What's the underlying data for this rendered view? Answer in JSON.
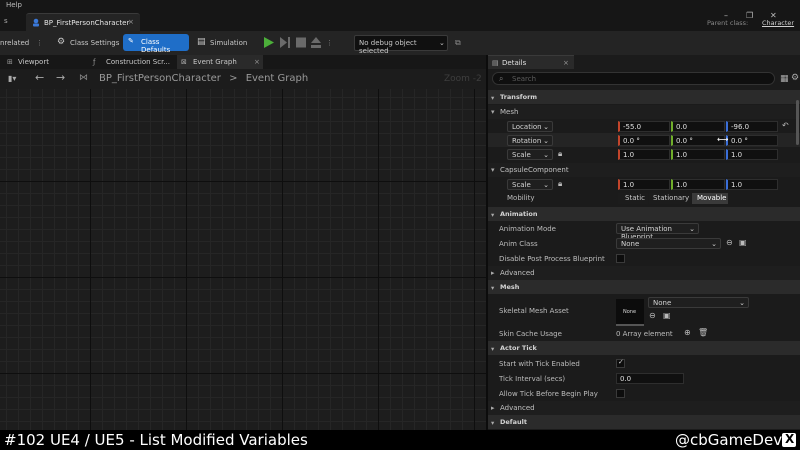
{
  "window": {
    "menu_help": "Help",
    "tab_title": "BP_FirstPersonCharacter",
    "tab_close": "×",
    "parent_class_label": "Parent class:",
    "parent_class_value": "Character"
  },
  "toolbar": {
    "unrelated": "nrelated",
    "class_settings": "Class Settings",
    "class_defaults": "Class Defaults",
    "simulation": "Simulation",
    "debug_object": "No debug object selected"
  },
  "left_tabs": [
    {
      "label": "Viewport"
    },
    {
      "label": "Construction Scr..."
    },
    {
      "label": "Event Graph",
      "close": "×"
    }
  ],
  "graph": {
    "breadcrumb_root": "BP_FirstPersonCharacter",
    "breadcrumb_sep": ">",
    "breadcrumb_leaf": "Event Graph",
    "zoom": "Zoom -2"
  },
  "details": {
    "tab_label": "Details",
    "tab_close": "×",
    "search_placeholder": "Search",
    "sections": {
      "transform": "Transform",
      "mesh_sub": "Mesh",
      "capsule_sub": "CapsuleComponent",
      "animation": "Animation",
      "advanced": "Advanced",
      "mesh": "Mesh",
      "actor_tick": "Actor Tick",
      "advanced2": "Advanced",
      "default": "Default"
    },
    "transform": {
      "location": {
        "label": "Location",
        "x": "-55.0",
        "y": "0.0",
        "z": "-96.0"
      },
      "rotation": {
        "label": "Rotation",
        "x": "0.0 °",
        "y": "0.0 °",
        "z": "0.0 °"
      },
      "scale": {
        "label": "Scale",
        "x": "1.0",
        "y": "1.0",
        "z": "1.0"
      },
      "capsule_scale": {
        "label": "Scale",
        "x": "1.0",
        "y": "1.0",
        "z": "1.0"
      },
      "mobility_label": "Mobility",
      "mobility_options": [
        "Static",
        "Stationary",
        "Movable"
      ],
      "mobility_selected": "Movable"
    },
    "animation": {
      "mode_label": "Animation Mode",
      "mode_value": "Use Animation Blueprint",
      "anim_class_label": "Anim Class",
      "anim_class_value": "None",
      "disable_pp_label": "Disable Post Process Blueprint"
    },
    "mesh": {
      "skeletal_label": "Skeletal Mesh Asset",
      "skeletal_thumb": "None",
      "skeletal_value": "None",
      "skin_cache_label": "Skin Cache Usage",
      "skin_cache_value": "0 Array element"
    },
    "actor_tick": {
      "start_label": "Start with Tick Enabled",
      "start_checked": true,
      "interval_label": "Tick Interval (secs)",
      "interval_value": "0.0",
      "allow_label": "Allow Tick Before Begin Play"
    }
  },
  "caption": {
    "title": "#102 UE4 / UE5 - List Modified Variables",
    "handle": "@cbGameDev"
  },
  "colors": {
    "accent_blue": "#1f6ec8",
    "axis_x": "#c4452b",
    "axis_y": "#70ae2a",
    "axis_z": "#3a6ed8",
    "play_green": "#4caf3a"
  }
}
